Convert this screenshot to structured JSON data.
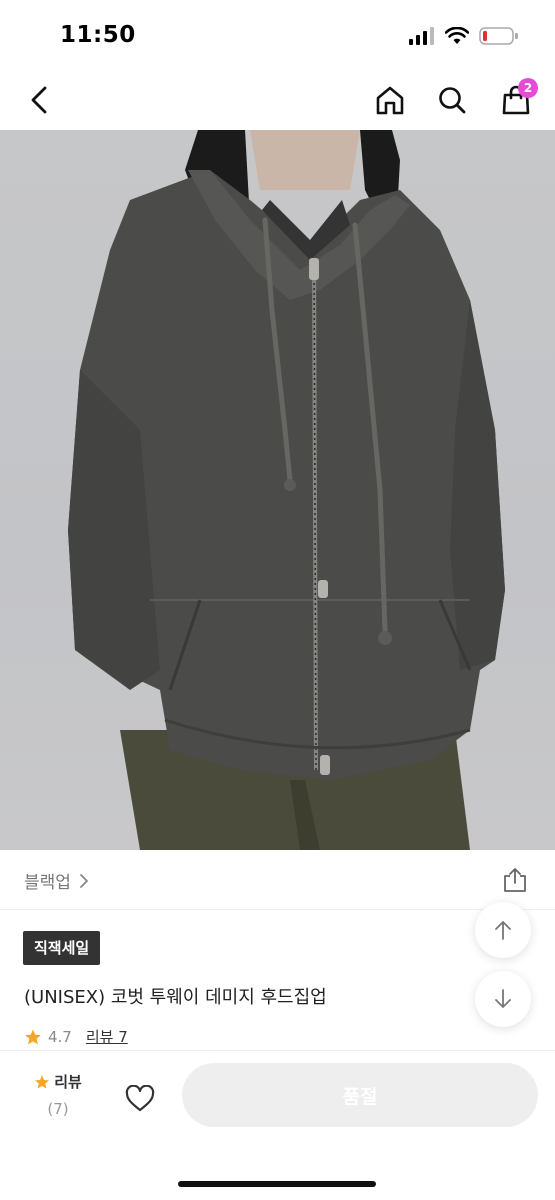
{
  "status": {
    "time": "11:50"
  },
  "nav": {
    "cart_count": "2"
  },
  "product": {
    "brand": "블랙업",
    "tag": "직잭세일",
    "title": "(UNISEX) 코벗 투웨이 데미지 후드집업",
    "rating": "4.7",
    "review_label": "리뷰 7"
  },
  "bottom": {
    "review_label": "리뷰",
    "review_count": "(7)",
    "buy_label": "품절"
  },
  "colors": {
    "accent_badge": "#e64bd8",
    "star": "#f5a623",
    "battery_low": "#e0303a"
  },
  "icons": [
    "back-icon",
    "home-icon",
    "search-icon",
    "shopping-bag-icon",
    "chevron-right-icon",
    "share-icon",
    "arrow-up-icon",
    "arrow-down-icon",
    "star-icon",
    "heart-icon"
  ]
}
